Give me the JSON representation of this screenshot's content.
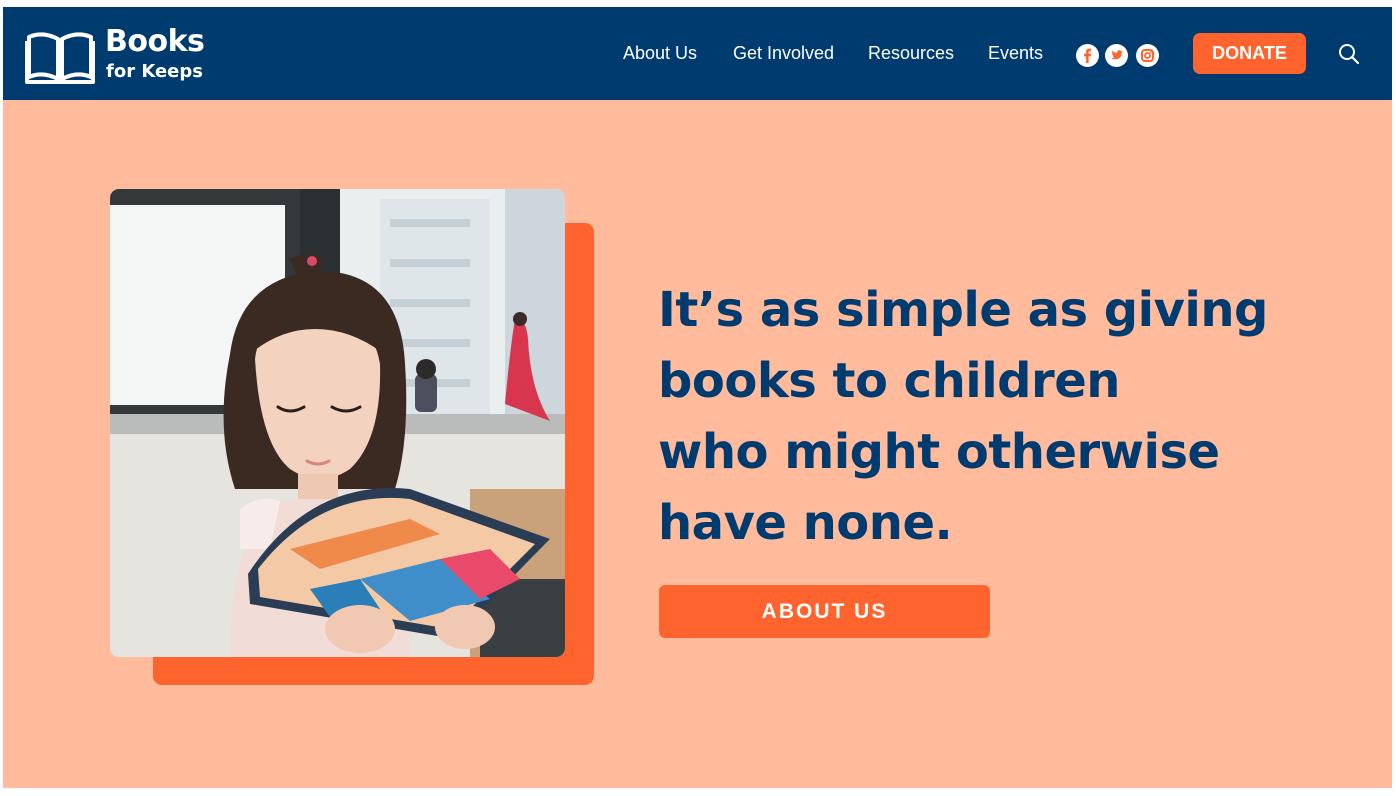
{
  "brand": {
    "title": "Books",
    "subtitle": "for Keeps"
  },
  "nav": {
    "items": [
      {
        "label": "About Us"
      },
      {
        "label": "Get Involved"
      },
      {
        "label": "Resources"
      },
      {
        "label": "Events"
      }
    ],
    "social": [
      "facebook-icon",
      "twitter-icon",
      "instagram-icon"
    ],
    "donate_label": "DONATE",
    "search_icon": "search-icon"
  },
  "hero": {
    "headline_lines": [
      "It’s as simple as giving",
      "books to children",
      "who might otherwise",
      "have none."
    ],
    "cta_label": "ABOUT US",
    "image_alt": "Young girl reading a book"
  },
  "colors": {
    "header_bg": "#003b6f",
    "page_bg": "#ffbb9c",
    "accent": "#ff632e",
    "headline": "#003b6f"
  }
}
